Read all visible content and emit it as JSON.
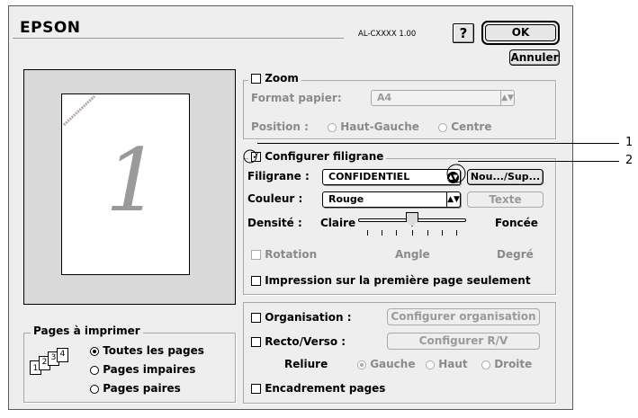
{
  "header": {
    "brand": "EPSON",
    "model": "AL-CXXXX 1.00",
    "help_label": "?",
    "ok_label": "OK",
    "cancel_label": "Annuler"
  },
  "preview": {
    "page_number": "1"
  },
  "zoom": {
    "title": "Zoom",
    "checked": false,
    "paper_label": "Format papier:",
    "paper_value": "A4",
    "position_label": "Position :",
    "options": [
      "Haut-Gauche",
      "Centre"
    ]
  },
  "watermark": {
    "title": "Configurer filigrane",
    "checked": true,
    "watermark_label": "Filigrane :",
    "watermark_value": "CONFIDENTIEL",
    "new_del_label": "Nou.../Sup...",
    "color_label": "Couleur :",
    "color_value": "Rouge",
    "text_button": "Texte",
    "density_label": "Densité :",
    "density_low": "Claire",
    "density_high": "Foncée",
    "density_level": 0.5,
    "rotation_label": "Rotation",
    "angle_label": "Angle",
    "degree_label": "Degré",
    "first_page_label": "Impression sur la première page seulement",
    "first_page_checked": false
  },
  "layout": {
    "organisation_label": "Organisation :",
    "organisation_button": "Configurer organisation",
    "duplex_label": "Recto/Verso :",
    "duplex_button": "Configurer R/V",
    "binding_label": "Reliure",
    "binding_options": [
      "Gauche",
      "Haut",
      "Droite"
    ],
    "border_label": "Encadrement pages"
  },
  "pages": {
    "title": "Pages à imprimer",
    "icon_digits": [
      "1",
      "2",
      "3",
      "4"
    ],
    "options": [
      "Toutes les pages",
      "Pages impaires",
      "Pages paires"
    ],
    "selected": 0
  },
  "callouts": [
    "1",
    "2"
  ]
}
